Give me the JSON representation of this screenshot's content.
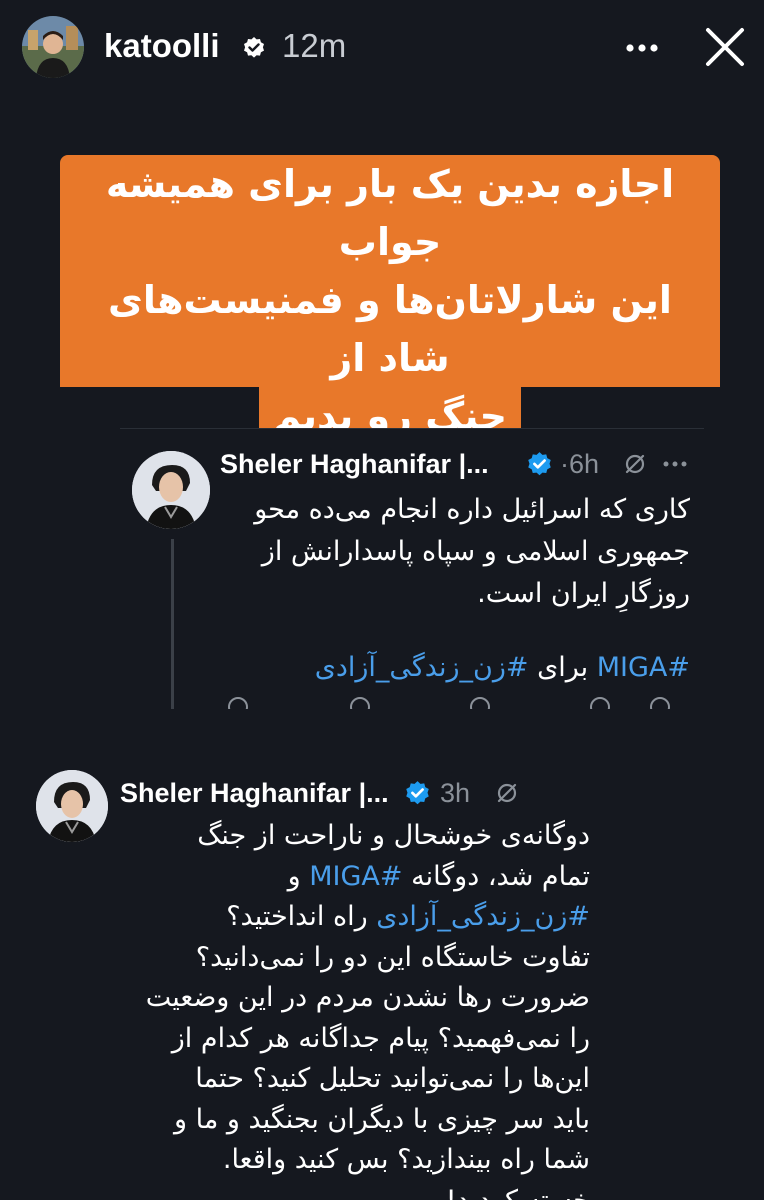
{
  "story": {
    "username": "katoolli",
    "time": "12m",
    "more_icon": "more-horizontal-icon",
    "close_icon": "close-icon"
  },
  "caption": {
    "lines": [
      "اجازه بدین یک بار برای همیشه جواب",
      "این شارلاتان‌ها و فمنیست‌های شاد از",
      "جنگ رو بدیم"
    ],
    "background_color": "#e8782a"
  },
  "tweet1": {
    "author": "Sheler Haghanifar |...",
    "time": "·6h",
    "body_lines": [
      "کاری که اسرائیل داره انجام می‌ده محو",
      "جمهوری اسلامی و سپاه پاسدارانش از",
      "روزگارِ ایران است."
    ],
    "hashtag_line": {
      "prefix_tag": "#MIGA",
      "middle": " برای ",
      "suffix_tag": "#زن_زندگی_آزادی"
    }
  },
  "tweet2": {
    "author": "Sheler Haghanifar |...",
    "time": "3h",
    "body_lines": [
      "دوگانه‌ی خوشحال و ناراحت از جنگ",
      "تمام شد، دوگانه ",
      "#زن_زندگی_آزادی",
      "تفاوت خاستگاه این دو را نمی‌دانید؟",
      "ضرورت رها نشدن مردم در این وضعیت",
      "را نمی‌فهمید؟ پیام جداگانه هر کدام از",
      "این‌ها را نمی‌توانید تحلیل کنید؟ حتما",
      "باید سر چیزی با دیگران بجنگید و ما و",
      "شما راه بیندازید؟ بس کنید واقعا.",
      "خسته کردید!"
    ],
    "line2_tag": "#MIGA",
    "line2_suffix": " و",
    "line3_suffix": " راه انداختید؟"
  },
  "colors": {
    "background": "#15181f",
    "link": "#4a9eea",
    "verified": "#1d9bf0",
    "meta": "#8b9199"
  }
}
